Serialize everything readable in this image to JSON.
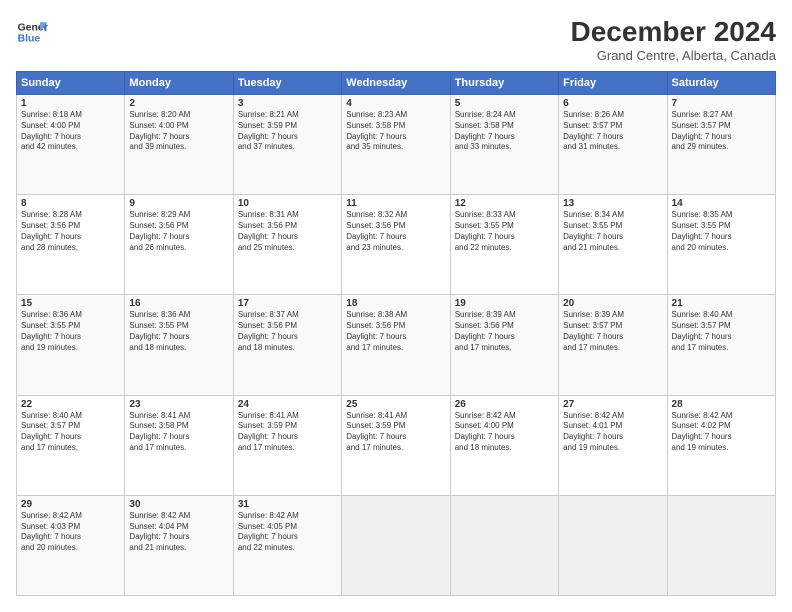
{
  "header": {
    "logo_line1": "General",
    "logo_line2": "Blue",
    "title": "December 2024",
    "subtitle": "Grand Centre, Alberta, Canada"
  },
  "days_of_week": [
    "Sunday",
    "Monday",
    "Tuesday",
    "Wednesday",
    "Thursday",
    "Friday",
    "Saturday"
  ],
  "weeks": [
    [
      {
        "day": "1",
        "info": "Sunrise: 8:18 AM\nSunset: 4:00 PM\nDaylight: 7 hours\nand 42 minutes."
      },
      {
        "day": "2",
        "info": "Sunrise: 8:20 AM\nSunset: 4:00 PM\nDaylight: 7 hours\nand 39 minutes."
      },
      {
        "day": "3",
        "info": "Sunrise: 8:21 AM\nSunset: 3:59 PM\nDaylight: 7 hours\nand 37 minutes."
      },
      {
        "day": "4",
        "info": "Sunrise: 8:23 AM\nSunset: 3:58 PM\nDaylight: 7 hours\nand 35 minutes."
      },
      {
        "day": "5",
        "info": "Sunrise: 8:24 AM\nSunset: 3:58 PM\nDaylight: 7 hours\nand 33 minutes."
      },
      {
        "day": "6",
        "info": "Sunrise: 8:26 AM\nSunset: 3:57 PM\nDaylight: 7 hours\nand 31 minutes."
      },
      {
        "day": "7",
        "info": "Sunrise: 8:27 AM\nSunset: 3:57 PM\nDaylight: 7 hours\nand 29 minutes."
      }
    ],
    [
      {
        "day": "8",
        "info": "Sunrise: 8:28 AM\nSunset: 3:56 PM\nDaylight: 7 hours\nand 28 minutes."
      },
      {
        "day": "9",
        "info": "Sunrise: 8:29 AM\nSunset: 3:56 PM\nDaylight: 7 hours\nand 26 minutes."
      },
      {
        "day": "10",
        "info": "Sunrise: 8:31 AM\nSunset: 3:56 PM\nDaylight: 7 hours\nand 25 minutes."
      },
      {
        "day": "11",
        "info": "Sunrise: 8:32 AM\nSunset: 3:56 PM\nDaylight: 7 hours\nand 23 minutes."
      },
      {
        "day": "12",
        "info": "Sunrise: 8:33 AM\nSunset: 3:55 PM\nDaylight: 7 hours\nand 22 minutes."
      },
      {
        "day": "13",
        "info": "Sunrise: 8:34 AM\nSunset: 3:55 PM\nDaylight: 7 hours\nand 21 minutes."
      },
      {
        "day": "14",
        "info": "Sunrise: 8:35 AM\nSunset: 3:55 PM\nDaylight: 7 hours\nand 20 minutes."
      }
    ],
    [
      {
        "day": "15",
        "info": "Sunrise: 8:36 AM\nSunset: 3:55 PM\nDaylight: 7 hours\nand 19 minutes."
      },
      {
        "day": "16",
        "info": "Sunrise: 8:36 AM\nSunset: 3:55 PM\nDaylight: 7 hours\nand 18 minutes."
      },
      {
        "day": "17",
        "info": "Sunrise: 8:37 AM\nSunset: 3:56 PM\nDaylight: 7 hours\nand 18 minutes."
      },
      {
        "day": "18",
        "info": "Sunrise: 8:38 AM\nSunset: 3:56 PM\nDaylight: 7 hours\nand 17 minutes."
      },
      {
        "day": "19",
        "info": "Sunrise: 8:39 AM\nSunset: 3:56 PM\nDaylight: 7 hours\nand 17 minutes."
      },
      {
        "day": "20",
        "info": "Sunrise: 8:39 AM\nSunset: 3:57 PM\nDaylight: 7 hours\nand 17 minutes."
      },
      {
        "day": "21",
        "info": "Sunrise: 8:40 AM\nSunset: 3:57 PM\nDaylight: 7 hours\nand 17 minutes."
      }
    ],
    [
      {
        "day": "22",
        "info": "Sunrise: 8:40 AM\nSunset: 3:57 PM\nDaylight: 7 hours\nand 17 minutes."
      },
      {
        "day": "23",
        "info": "Sunrise: 8:41 AM\nSunset: 3:58 PM\nDaylight: 7 hours\nand 17 minutes."
      },
      {
        "day": "24",
        "info": "Sunrise: 8:41 AM\nSunset: 3:59 PM\nDaylight: 7 hours\nand 17 minutes."
      },
      {
        "day": "25",
        "info": "Sunrise: 8:41 AM\nSunset: 3:59 PM\nDaylight: 7 hours\nand 17 minutes."
      },
      {
        "day": "26",
        "info": "Sunrise: 8:42 AM\nSunset: 4:00 PM\nDaylight: 7 hours\nand 18 minutes."
      },
      {
        "day": "27",
        "info": "Sunrise: 8:42 AM\nSunset: 4:01 PM\nDaylight: 7 hours\nand 19 minutes."
      },
      {
        "day": "28",
        "info": "Sunrise: 8:42 AM\nSunset: 4:02 PM\nDaylight: 7 hours\nand 19 minutes."
      }
    ],
    [
      {
        "day": "29",
        "info": "Sunrise: 8:42 AM\nSunset: 4:03 PM\nDaylight: 7 hours\nand 20 minutes."
      },
      {
        "day": "30",
        "info": "Sunrise: 8:42 AM\nSunset: 4:04 PM\nDaylight: 7 hours\nand 21 minutes."
      },
      {
        "day": "31",
        "info": "Sunrise: 8:42 AM\nSunset: 4:05 PM\nDaylight: 7 hours\nand 22 minutes."
      },
      {
        "day": "",
        "info": ""
      },
      {
        "day": "",
        "info": ""
      },
      {
        "day": "",
        "info": ""
      },
      {
        "day": "",
        "info": ""
      }
    ]
  ]
}
